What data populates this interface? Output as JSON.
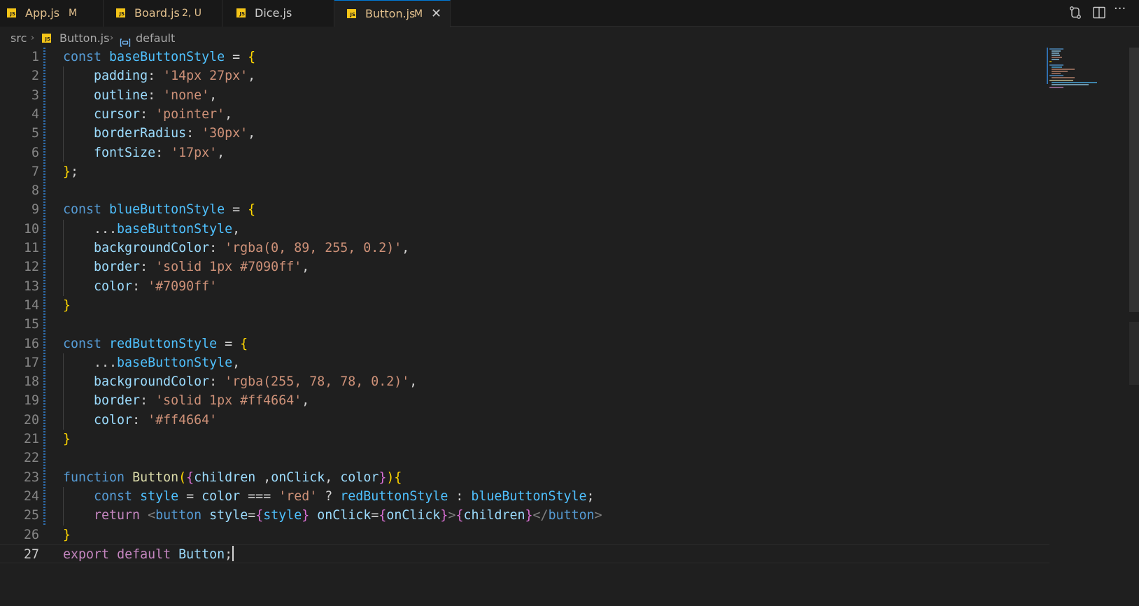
{
  "tabs": [
    {
      "name": "App.js",
      "badge": "M",
      "name_color": "#e2c08d",
      "active": false
    },
    {
      "name": "Board.js",
      "badge": "2, U",
      "name_color": "#e2c08d",
      "active": false
    },
    {
      "name": "Dice.js",
      "badge": "",
      "name_color": "#cccccc",
      "active": false
    },
    {
      "name": "Button.js",
      "badge": "M",
      "name_color": "#e2c08d",
      "active": true,
      "close": "✕"
    }
  ],
  "js_icon_text": "JS",
  "actions": [
    "source-control-compare-icon",
    "split-editor-icon",
    "more-actions-icon"
  ],
  "more_actions_glyph": "···",
  "breadcrumb": {
    "folder": "src",
    "file": "Button.js",
    "symbol": "default",
    "separator": "›"
  },
  "editor": {
    "current_line": 27,
    "lines": [
      "const baseButtonStyle = {",
      "    padding: '14px 27px',",
      "    outline: 'none',",
      "    cursor: 'pointer',",
      "    borderRadius: '30px',",
      "    fontSize: '17px',",
      "};",
      "",
      "const blueButtonStyle = {",
      "    ...baseButtonStyle,",
      "    backgroundColor: 'rgba(0, 89, 255, 0.2)',",
      "    border: 'solid 1px #7090ff',",
      "    color: '#7090ff'",
      "}",
      "",
      "const redButtonStyle = {",
      "    ...baseButtonStyle,",
      "    backgroundColor: 'rgba(255, 78, 78, 0.2)',",
      "    border: 'solid 1px #ff4664',",
      "    color: '#ff4664'",
      "}",
      "",
      "function Button({children ,onClick, color}){",
      "    const style = color === 'red' ? redButtonStyle : blueButtonStyle;",
      "    return <button style={style} onClick={onClick}>{children}</button>",
      "}",
      "export default Button;"
    ]
  },
  "theme": {
    "background": "#1f1f1f",
    "tab_bar": "#181818",
    "accent": "#0078d4",
    "modified_color": "#e2c08d"
  }
}
